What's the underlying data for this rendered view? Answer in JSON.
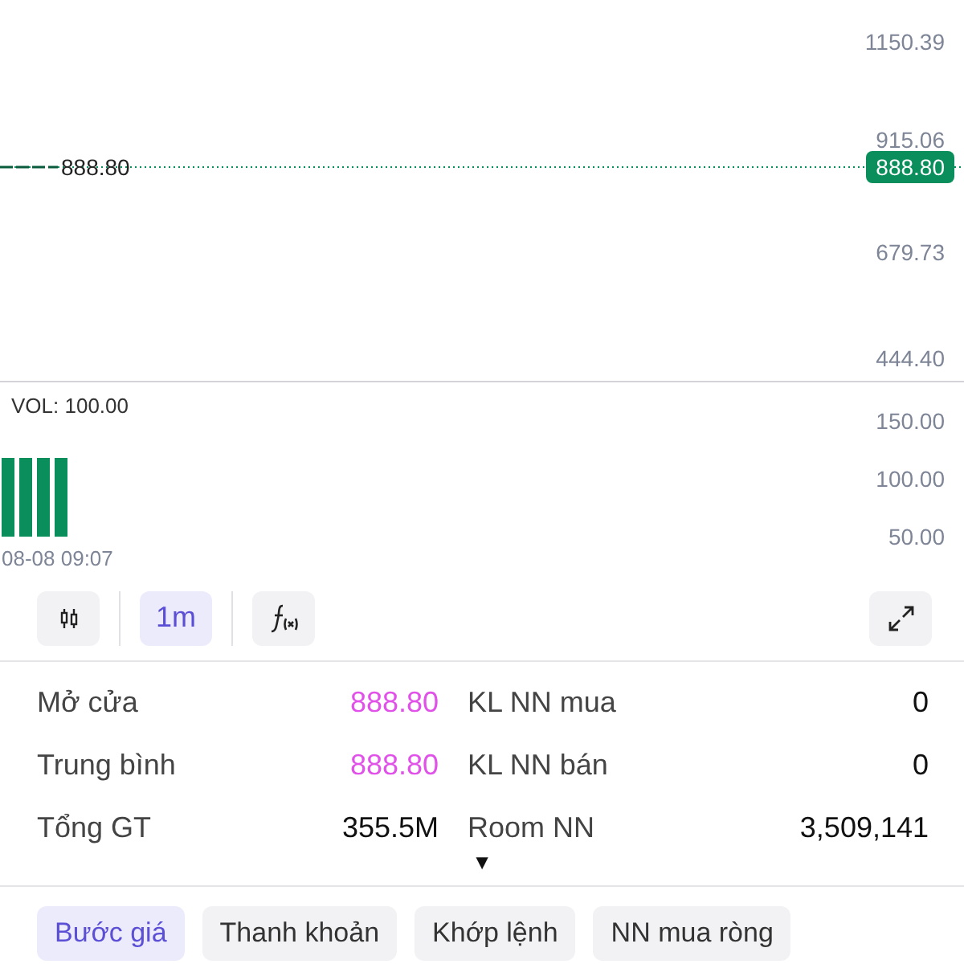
{
  "price_chart": {
    "last_price_label": "888.80",
    "price_badge": "888.80",
    "axis_labels": [
      "1150.39",
      "915.06",
      "679.73",
      "444.40"
    ]
  },
  "volume_chart": {
    "title": "VOL: 100.00",
    "time_label": "08-08 09:07",
    "axis_labels": [
      "150.00",
      "100.00",
      "50.00"
    ]
  },
  "toolbar": [
    {
      "kind": "candles"
    },
    {
      "kind": "text",
      "label": "1m",
      "selected": true
    },
    {
      "kind": "function"
    },
    {
      "kind": "expand"
    }
  ],
  "stats": [
    {
      "label": "Mở cửa",
      "value": "888.80",
      "highlight": true
    },
    {
      "label": "KL NN mua",
      "value": "0",
      "highlight": false
    },
    {
      "label": "Trung bình",
      "value": "888.80",
      "highlight": true
    },
    {
      "label": "KL NN bán",
      "value": "0",
      "highlight": false
    },
    {
      "label": "Tổng GT",
      "value": "355.5M",
      "highlight": false
    },
    {
      "label": "Room NN",
      "value": "3,509,141",
      "highlight": false
    }
  ],
  "expand_toggle": "▼",
  "tabs": [
    {
      "label": "Bước giá",
      "selected": true
    },
    {
      "label": "Thanh khoản",
      "selected": false
    },
    {
      "label": "Khớp lệnh",
      "selected": false
    },
    {
      "label": "NN mua ròng",
      "selected": false
    }
  ]
}
